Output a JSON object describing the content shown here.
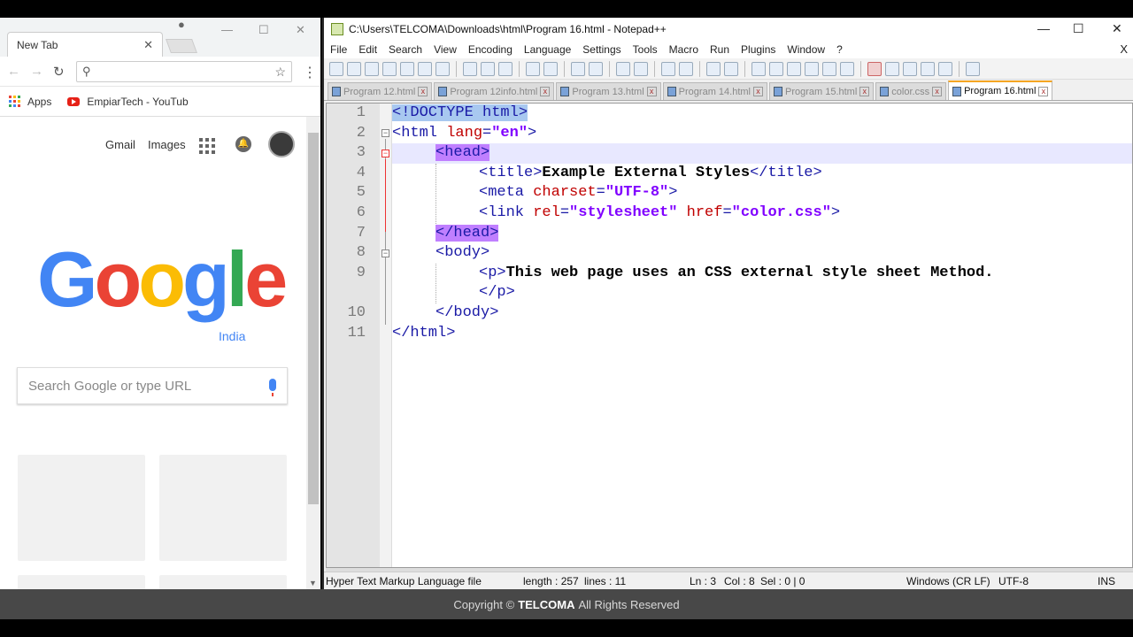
{
  "chrome": {
    "tab_title": "New Tab",
    "tab_close": "✕",
    "bookmarks": {
      "apps_label": "Apps",
      "youtube_label": "EmpiarTech - YouTub"
    },
    "header_links": {
      "gmail": "Gmail",
      "images": "Images"
    },
    "logo_letters": [
      "G",
      "o",
      "o",
      "g",
      "l",
      "e"
    ],
    "logo_colors": [
      "#4285f4",
      "#ea4335",
      "#fbbc05",
      "#4285f4",
      "#34a853",
      "#ea4335"
    ],
    "logo_region": "India",
    "search_placeholder": "Search Google or type URL"
  },
  "npp": {
    "window_title": "C:\\Users\\TELCOMA\\Downloads\\html\\Program 16.html - Notepad++",
    "menu": [
      "File",
      "Edit",
      "Search",
      "View",
      "Encoding",
      "Language",
      "Settings",
      "Tools",
      "Macro",
      "Run",
      "Plugins",
      "Window",
      "?"
    ],
    "menu_close": "X",
    "tabs": [
      {
        "label": "Program 12.html",
        "active": false
      },
      {
        "label": "Program 12info.html",
        "active": false
      },
      {
        "label": "Program 13.html",
        "active": false
      },
      {
        "label": "Program 14.html",
        "active": false
      },
      {
        "label": "Program 15.html",
        "active": false
      },
      {
        "label": "color.css",
        "active": false
      },
      {
        "label": "Program 16.html",
        "active": true
      }
    ],
    "line_numbers": [
      "1",
      "2",
      "3",
      "4",
      "5",
      "6",
      "7",
      "8",
      "9",
      "",
      "10",
      "11"
    ],
    "code": {
      "l1_tag": "<!DOCTYPE html>",
      "l2_open": "<html ",
      "l2_attr": "lang",
      "l2_eq": "=",
      "l2_val": "\"en\"",
      "l2_close": ">",
      "l3": "<head>",
      "l4_open": "<title>",
      "l4_text": "Example External Styles",
      "l4_close": "</title>",
      "l5_open": "<meta ",
      "l5_attr": "charset",
      "l5_eq": "=",
      "l5_val": "\"UTF-8\"",
      "l5_close": ">",
      "l6_open": "<link ",
      "l6_attr1": "rel",
      "l6_eq": "=",
      "l6_val1": "\"stylesheet\"",
      "l6_attr2": " href",
      "l6_val2": "\"color.css\"",
      "l6_close": ">",
      "l7": "</head>",
      "l8": "<body>",
      "l9_open": "<p>",
      "l9_text": "This web page uses an CSS external style sheet Method.",
      "l9b_close": "</p>",
      "l10": "</body>",
      "l11": "</html>"
    },
    "status": {
      "file_type": "Hyper Text Markup Language file",
      "length": "length : 257",
      "lines": "lines : 11",
      "ln": "Ln : 3",
      "col": "Col : 8",
      "sel": "Sel : 0 | 0",
      "eol": "Windows (CR LF)",
      "encoding": "UTF-8",
      "mode": "INS"
    }
  },
  "footer": {
    "prefix": "Copyright ©",
    "brand": "TELCOMA",
    "suffix": "All Rights Reserved"
  }
}
